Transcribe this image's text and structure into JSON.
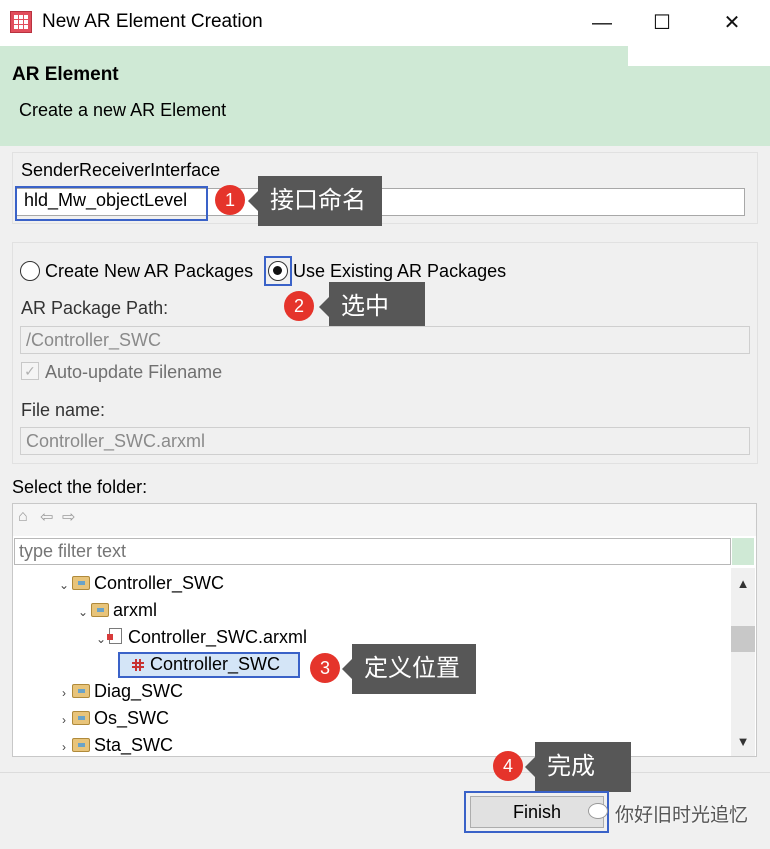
{
  "window": {
    "title": "New AR Element Creation",
    "minimize": "—",
    "maximize": "☐",
    "close": "✕"
  },
  "header": {
    "title": "AR Element",
    "subtitle": "Create a new AR Element"
  },
  "interface": {
    "label": "SenderReceiverInterface",
    "value": "hld_Mw_objectLevel"
  },
  "packages": {
    "option_create": "Create New AR Packages",
    "option_existing": "Use Existing AR Packages",
    "selected": "Use Existing AR Packages",
    "path_label": "AR Package Path:",
    "path_value": "/Controller_SWC",
    "auto_update_label": "Auto-update Filename",
    "auto_update_checked": true,
    "file_label": "File name:",
    "file_value": "Controller_SWC.arxml"
  },
  "folder": {
    "label": "Select the folder:",
    "filter_placeholder": "type filter text",
    "tree": [
      {
        "label": "Controller_SWC",
        "type": "folder",
        "expanded": true
      },
      {
        "label": "arxml",
        "type": "folder",
        "expanded": true
      },
      {
        "label": "Controller_SWC.arxml",
        "type": "file",
        "expanded": true
      },
      {
        "label": "Controller_SWC",
        "type": "element",
        "selected": true
      },
      {
        "label": "Diag_SWC",
        "type": "folder",
        "expanded": false
      },
      {
        "label": "Os_SWC",
        "type": "folder",
        "expanded": false
      },
      {
        "label": "Sta_SWC",
        "type": "folder",
        "expanded": false
      }
    ]
  },
  "buttons": {
    "finish": "Finish"
  },
  "annotations": [
    {
      "number": "1",
      "text": "接口命名"
    },
    {
      "number": "2",
      "text": "选中"
    },
    {
      "number": "3",
      "text": "定义位置"
    },
    {
      "number": "4",
      "text": "完成"
    }
  ],
  "watermark": "你好旧时光追忆",
  "colors": {
    "header_bg": "#cfe9d5",
    "highlight": "#3a62c8",
    "badge": "#e5342b",
    "callout": "#575757"
  }
}
